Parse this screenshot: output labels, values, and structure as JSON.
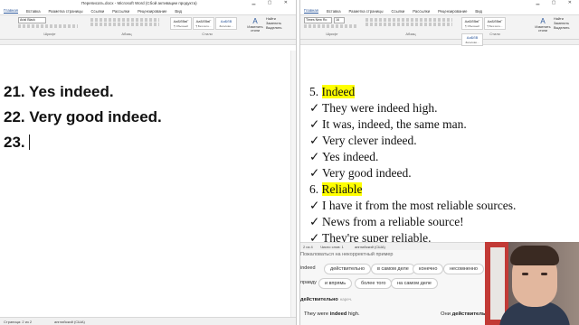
{
  "left_window": {
    "title": "Переписать.docx - Microsoft Word (Сбой активации продукта)",
    "tabs": [
      "Главная",
      "Вставка",
      "Разметка страницы",
      "Ссылки",
      "Рассылки",
      "Рецензирование",
      "Вид"
    ],
    "font_name": "Arial Black",
    "ribbon_groups": [
      "Шрифт",
      "Абзац",
      "Стили"
    ],
    "styles": [
      {
        "sample": "АаБбВвГ",
        "name": "¶ Обычный"
      },
      {
        "sample": "АаБбВвГ",
        "name": "¶ Без инте..."
      },
      {
        "sample": "АаБбВ",
        "name": "Заголово..."
      }
    ],
    "change_styles": "Изменить стили",
    "editing": [
      "Найти",
      "Заменить",
      "Выделить"
    ],
    "lines": [
      "21. Yes indeed.",
      "22. Very good indeed.",
      "23."
    ],
    "status_page": "Страница: 2 из 2",
    "status_lang": "английский (США)"
  },
  "right_window": {
    "font_name": "Times New Ro",
    "font_size": "16",
    "lines": [
      {
        "text": "5. ",
        "highlight": "Indeed",
        "type": "heading"
      },
      {
        "text": "They were indeed high.",
        "type": "check"
      },
      {
        "text": "It was, indeed, the same man.",
        "type": "check"
      },
      {
        "text": "Very clever indeed.",
        "type": "check"
      },
      {
        "text": "Yes indeed.",
        "type": "check"
      },
      {
        "text": "Very good indeed.",
        "type": "check"
      },
      {
        "text": "6. ",
        "highlight": "Reliable",
        "type": "heading"
      },
      {
        "text": "I have it from the most reliable sources.",
        "type": "check"
      },
      {
        "text": "News from a reliable source!",
        "type": "check"
      },
      {
        "text": "They're super reliable.",
        "type": "check"
      }
    ],
    "status_page": "2 из 4",
    "status_words": "Число слов: 1",
    "status_lang": "английский (США)"
  },
  "translator": {
    "suggestion": "Пожаловаться на некорректный пример",
    "row1": [
      "indeed",
      "действительно",
      "в самом деле",
      "конечно",
      "несомненно"
    ],
    "row2": [
      "правду",
      "и впрямь",
      "более того",
      "на самом деле"
    ],
    "word": "действительно",
    "word_pos": "нареч.",
    "example_en_pre": "They were ",
    "example_en_bold": "indeed",
    "example_en_post": " high.",
    "example_ru_pre": "Они ",
    "example_ru_bold": "действительно"
  },
  "icons": {
    "check": "✓",
    "caret": "|"
  },
  "colors": {
    "highlight": "#ffff00",
    "word_blue": "#2b579a"
  }
}
